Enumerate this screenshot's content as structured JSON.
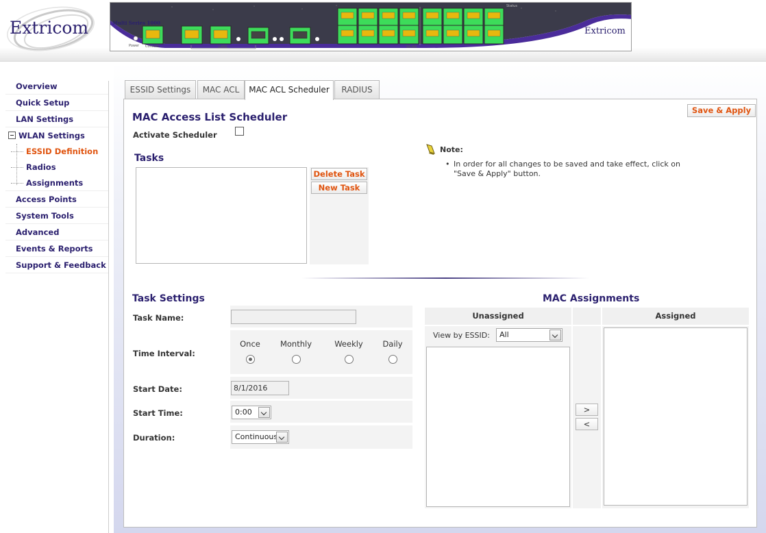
{
  "brand": {
    "logo_text": "Extricom",
    "device_model": "Multi Series 1000",
    "device_logo_text": "Extricom"
  },
  "device_labels": {
    "power": "Power",
    "console": "Console",
    "lan1": "LAN1",
    "wlan": "WLAN",
    "status": "Status"
  },
  "nav": {
    "overview": "Overview",
    "quick_setup": "Quick Setup",
    "lan_settings": "LAN Settings",
    "wlan_settings": "WLAN Settings",
    "essid_definition": "ESSID Definition",
    "radios": "Radios",
    "assignments": "Assignments",
    "access_points": "Access Points",
    "system_tools": "System Tools",
    "advanced": "Advanced",
    "events_reports": "Events & Reports",
    "support_feedback": "Support & Feedback"
  },
  "tabs": {
    "essid_settings": "ESSID Settings",
    "mac_acl": "MAC ACL",
    "mac_acl_scheduler": "MAC ACL Scheduler",
    "radius": "RADIUS"
  },
  "page": {
    "title": "MAC Access List Scheduler",
    "save_apply": "Save & Apply",
    "activate_scheduler": "Activate Scheduler"
  },
  "tasks": {
    "heading": "Tasks",
    "delete_task": "Delete Task",
    "new_task": "New Task"
  },
  "note": {
    "title": "Note:",
    "text": "In order for all changes to be saved and take effect, click on \"Save & Apply\" button."
  },
  "task_settings": {
    "heading": "Task Settings",
    "task_name_label": "Task Name:",
    "task_name_value": "",
    "time_interval_label": "Time Interval:",
    "intervals": {
      "once": "Once",
      "monthly": "Monthly",
      "weekly": "Weekly",
      "daily": "Daily"
    },
    "selected_interval": "Once",
    "start_date_label": "Start Date:",
    "start_date_value": "8/1/2016",
    "start_time_label": "Start Time:",
    "start_time_value": "0:00",
    "duration_label": "Duration:",
    "duration_value": "Continuous"
  },
  "mac_assignments": {
    "heading": "MAC Assignments",
    "unassigned_label": "Unassigned",
    "assigned_label": "Assigned",
    "view_by_label": "View by ESSID:",
    "view_by_value": "All",
    "move_right": ">",
    "move_left": "<"
  },
  "colors": {
    "brand": "#2a1f6e",
    "accent": "#e0540f",
    "port_green": "#3ddc5a"
  }
}
